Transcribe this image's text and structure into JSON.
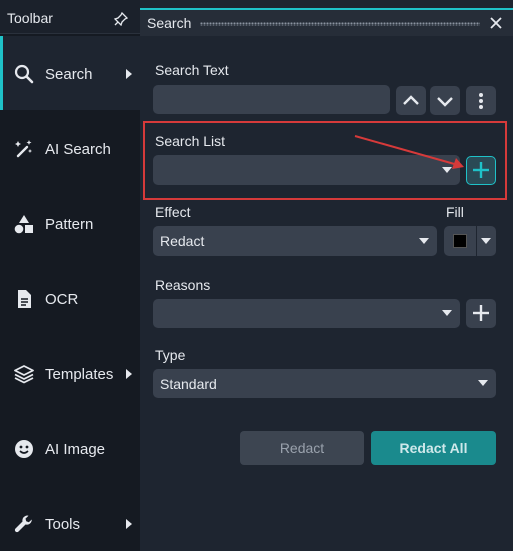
{
  "toolbar": {
    "title": "Toolbar",
    "items": [
      {
        "label": "Search",
        "icon": "search-icon",
        "has_arrow": true,
        "active": true
      },
      {
        "label": "AI Search",
        "icon": "magic-wand-icon",
        "has_arrow": false
      },
      {
        "label": "Pattern",
        "icon": "shapes-icon",
        "has_arrow": false
      },
      {
        "label": "OCR",
        "icon": "document-icon",
        "has_arrow": false
      },
      {
        "label": "Templates",
        "icon": "layers-icon",
        "has_arrow": true
      },
      {
        "label": "AI Image",
        "icon": "face-icon",
        "has_arrow": false
      },
      {
        "label": "Tools",
        "icon": "wrench-icon",
        "has_arrow": true
      }
    ]
  },
  "panel": {
    "title": "Search",
    "search_text_label": "Search Text",
    "search_text_value": "",
    "search_list_label": "Search List",
    "search_list_value": "",
    "effect_label": "Effect",
    "effect_value": "Redact",
    "fill_label": "Fill",
    "fill_color": "#000000",
    "reasons_label": "Reasons",
    "reasons_value": "",
    "type_label": "Type",
    "type_value": "Standard",
    "redact_label": "Redact",
    "redact_all_label": "Redact All"
  },
  "colors": {
    "accent": "#1fc2c8",
    "highlight": "#d63a3a",
    "primary_button": "#1a8a8d"
  }
}
